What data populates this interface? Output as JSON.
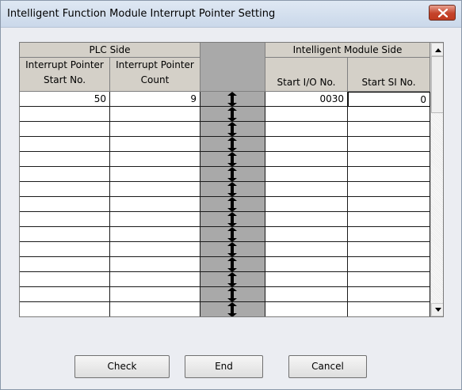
{
  "window": {
    "title": "Intelligent Function Module Interrupt Pointer Setting",
    "close_icon": "close-icon"
  },
  "grid": {
    "group_plc": "PLC Side",
    "group_module": "Intelligent Module Side",
    "col_start_no_line1": "Interrupt Pointer",
    "col_start_no_line2": "Start No.",
    "col_count_line1": "Interrupt Pointer",
    "col_count_line2": "Count",
    "col_start_io": "Start I/O No.",
    "col_start_si": "Start SI No.",
    "separator_icon": "double-arrow-icon",
    "rows": [
      {
        "start_no": "50",
        "count": "9",
        "start_io": "0030",
        "start_si": "0"
      },
      {
        "start_no": "",
        "count": "",
        "start_io": "",
        "start_si": ""
      },
      {
        "start_no": "",
        "count": "",
        "start_io": "",
        "start_si": ""
      },
      {
        "start_no": "",
        "count": "",
        "start_io": "",
        "start_si": ""
      },
      {
        "start_no": "",
        "count": "",
        "start_io": "",
        "start_si": ""
      },
      {
        "start_no": "",
        "count": "",
        "start_io": "",
        "start_si": ""
      },
      {
        "start_no": "",
        "count": "",
        "start_io": "",
        "start_si": ""
      },
      {
        "start_no": "",
        "count": "",
        "start_io": "",
        "start_si": ""
      },
      {
        "start_no": "",
        "count": "",
        "start_io": "",
        "start_si": ""
      },
      {
        "start_no": "",
        "count": "",
        "start_io": "",
        "start_si": ""
      },
      {
        "start_no": "",
        "count": "",
        "start_io": "",
        "start_si": ""
      },
      {
        "start_no": "",
        "count": "",
        "start_io": "",
        "start_si": ""
      },
      {
        "start_no": "",
        "count": "",
        "start_io": "",
        "start_si": ""
      },
      {
        "start_no": "",
        "count": "",
        "start_io": "",
        "start_si": ""
      },
      {
        "start_no": "",
        "count": "",
        "start_io": "",
        "start_si": ""
      }
    ]
  },
  "buttons": {
    "check": "Check",
    "end": "End",
    "cancel": "Cancel"
  }
}
